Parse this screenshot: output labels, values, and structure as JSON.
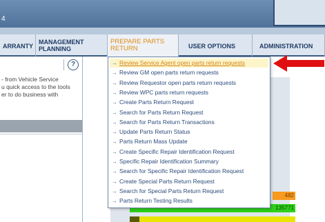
{
  "header": {
    "fragment_text": "4"
  },
  "nav": {
    "tabs": [
      {
        "id": "warranty",
        "label": "ARRANTY"
      },
      {
        "id": "mgmt",
        "label": "MANAGEMENT\nPLANNING"
      },
      {
        "id": "prepare",
        "label": "PREPARE PARTS\nRETURN"
      },
      {
        "id": "user",
        "label": "USER OPTIONS"
      },
      {
        "id": "admin",
        "label": "ADMINISTRATION"
      }
    ]
  },
  "left_panel": {
    "help_label": "?",
    "text": "- from Vehicle Service\nu quick access to the tools\ner to do business with"
  },
  "menu": {
    "items": [
      {
        "label": "Review Service Agent open parts return requests",
        "highlighted": true
      },
      {
        "label": "Review GM open parts return requests"
      },
      {
        "label": "Review Requestor open parts return requests"
      },
      {
        "label": "Review WPC parts return requests"
      },
      {
        "label": "Create Parts Return Request"
      },
      {
        "label": "Search for Parts Return Request"
      },
      {
        "label": "Search for Parts Return Transactions"
      },
      {
        "label": "Update Parts Return Status"
      },
      {
        "label": "Parts Return Mass Update"
      },
      {
        "label": "Create Specific Repair Identification Request"
      },
      {
        "label": "Specific Repair Identification Summary"
      },
      {
        "label": "Search for Specific Repair Identification Request"
      },
      {
        "label": "Create Special Parts Return Request"
      },
      {
        "label": "Search for Special Parts Return Request"
      },
      {
        "label": "Parts Return Testing Results"
      }
    ],
    "arrow_glyph": "→"
  },
  "background_values": {
    "orange_value": "482",
    "green_value": "135771"
  },
  "colors": {
    "highlight": "#d4831a",
    "pointer": "#e01010",
    "nav_text": "#1f3a63"
  }
}
